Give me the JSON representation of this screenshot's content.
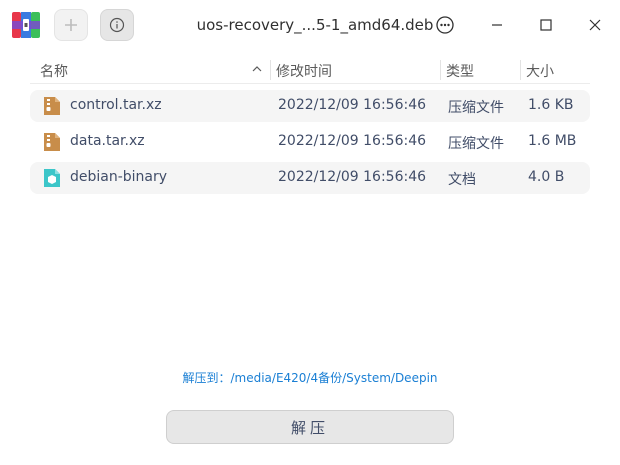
{
  "window": {
    "title": "uos-recovery_...5-1_amd64.deb"
  },
  "toolbar": {
    "add_icon": "plus-icon",
    "info_icon": "info-icon"
  },
  "table": {
    "columns": [
      {
        "label": "名称"
      },
      {
        "label": "修改时间"
      },
      {
        "label": "类型"
      },
      {
        "label": "大小"
      }
    ],
    "rows": [
      {
        "name": "control.tar.xz",
        "modified": "2022/12/09 16:56:46",
        "type": "压缩文件",
        "size": "1.6 KB",
        "icon": "archive-file-icon"
      },
      {
        "name": "data.tar.xz",
        "modified": "2022/12/09 16:56:46",
        "type": "压缩文件",
        "size": "1.6 MB",
        "icon": "archive-file-icon"
      },
      {
        "name": "debian-binary",
        "modified": "2022/12/09 16:56:46",
        "type": "文档",
        "size": "4.0 B",
        "icon": "document-file-icon"
      }
    ]
  },
  "footer": {
    "extract_path": "解压到：/media/E420/4备份/System/Deepin",
    "extract_button": "解压"
  },
  "colors": {
    "accent": "#1a7fd4",
    "archive_icon": "#c88d4a",
    "document_icon": "#3cc6c9"
  }
}
